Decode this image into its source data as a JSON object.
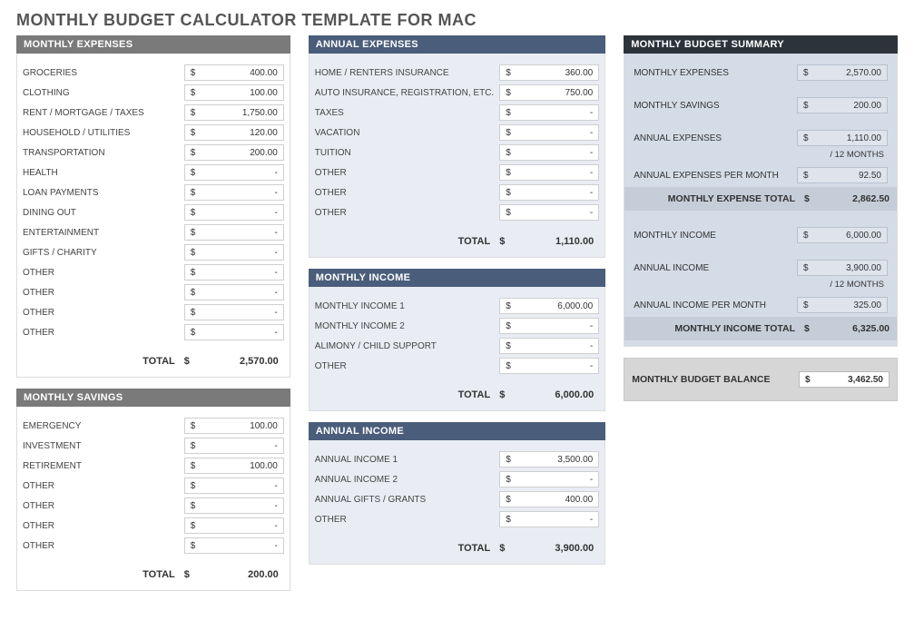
{
  "title": "MONTHLY BUDGET CALCULATOR TEMPLATE FOR MAC",
  "labels": {
    "total": "TOTAL",
    "per12": "/ 12 MONTHS"
  },
  "sections": {
    "monthly_expenses": {
      "title": "MONTHLY EXPENSES",
      "rows": [
        {
          "label": "GROCERIES",
          "value": "400.00"
        },
        {
          "label": "CLOTHING",
          "value": "100.00"
        },
        {
          "label": "RENT / MORTGAGE / TAXES",
          "value": "1,750.00"
        },
        {
          "label": "HOUSEHOLD / UTILITIES",
          "value": "120.00"
        },
        {
          "label": "TRANSPORTATION",
          "value": "200.00"
        },
        {
          "label": "HEALTH",
          "value": "-"
        },
        {
          "label": "LOAN PAYMENTS",
          "value": "-"
        },
        {
          "label": "DINING OUT",
          "value": "-"
        },
        {
          "label": "ENTERTAINMENT",
          "value": "-"
        },
        {
          "label": "GIFTS / CHARITY",
          "value": "-"
        },
        {
          "label": "OTHER",
          "value": "-"
        },
        {
          "label": "OTHER",
          "value": "-"
        },
        {
          "label": "OTHER",
          "value": "-"
        },
        {
          "label": "OTHER",
          "value": "-"
        }
      ],
      "total": "2,570.00"
    },
    "monthly_savings": {
      "title": "MONTHLY SAVINGS",
      "rows": [
        {
          "label": "EMERGENCY",
          "value": "100.00"
        },
        {
          "label": "INVESTMENT",
          "value": "-"
        },
        {
          "label": "RETIREMENT",
          "value": "100.00"
        },
        {
          "label": "OTHER",
          "value": "-"
        },
        {
          "label": "OTHER",
          "value": "-"
        },
        {
          "label": "OTHER",
          "value": "-"
        },
        {
          "label": "OTHER",
          "value": "-"
        }
      ],
      "total": "200.00"
    },
    "annual_expenses": {
      "title": "ANNUAL EXPENSES",
      "rows": [
        {
          "label": "HOME / RENTERS INSURANCE",
          "value": "360.00"
        },
        {
          "label": "AUTO INSURANCE, REGISTRATION, ETC.",
          "value": "750.00"
        },
        {
          "label": "TAXES",
          "value": "-"
        },
        {
          "label": "VACATION",
          "value": "-"
        },
        {
          "label": "TUITION",
          "value": "-"
        },
        {
          "label": "OTHER",
          "value": "-"
        },
        {
          "label": "OTHER",
          "value": "-"
        },
        {
          "label": "OTHER",
          "value": "-"
        }
      ],
      "total": "1,110.00"
    },
    "monthly_income": {
      "title": "MONTHLY INCOME",
      "rows": [
        {
          "label": "MONTHLY INCOME 1",
          "value": "6,000.00"
        },
        {
          "label": "MONTHLY INCOME 2",
          "value": "-"
        },
        {
          "label": "ALIMONY / CHILD SUPPORT",
          "value": "-"
        },
        {
          "label": "OTHER",
          "value": "-"
        }
      ],
      "total": "6,000.00"
    },
    "annual_income": {
      "title": "ANNUAL INCOME",
      "rows": [
        {
          "label": "ANNUAL INCOME 1",
          "value": "3,500.00"
        },
        {
          "label": "ANNUAL INCOME 2",
          "value": "-"
        },
        {
          "label": "ANNUAL GIFTS / GRANTS",
          "value": "400.00"
        },
        {
          "label": "OTHER",
          "value": "-"
        }
      ],
      "total": "3,900.00"
    }
  },
  "summary": {
    "title": "MONTHLY BUDGET SUMMARY",
    "monthly_expenses_label": "MONTHLY EXPENSES",
    "monthly_expenses_value": "2,570.00",
    "monthly_savings_label": "MONTHLY SAVINGS",
    "monthly_savings_value": "200.00",
    "annual_expenses_label": "ANNUAL EXPENSES",
    "annual_expenses_value": "1,110.00",
    "annual_expenses_pm_label": "ANNUAL EXPENSES PER MONTH",
    "annual_expenses_pm_value": "92.50",
    "expense_total_label": "MONTHLY EXPENSE TOTAL",
    "expense_total_value": "2,862.50",
    "monthly_income_label": "MONTHLY INCOME",
    "monthly_income_value": "6,000.00",
    "annual_income_label": "ANNUAL INCOME",
    "annual_income_value": "3,900.00",
    "annual_income_pm_label": "ANNUAL INCOME PER MONTH",
    "annual_income_pm_value": "325.00",
    "income_total_label": "MONTHLY INCOME TOTAL",
    "income_total_value": "6,325.00"
  },
  "balance": {
    "label": "MONTHLY BUDGET BALANCE",
    "value": "3,462.50"
  }
}
